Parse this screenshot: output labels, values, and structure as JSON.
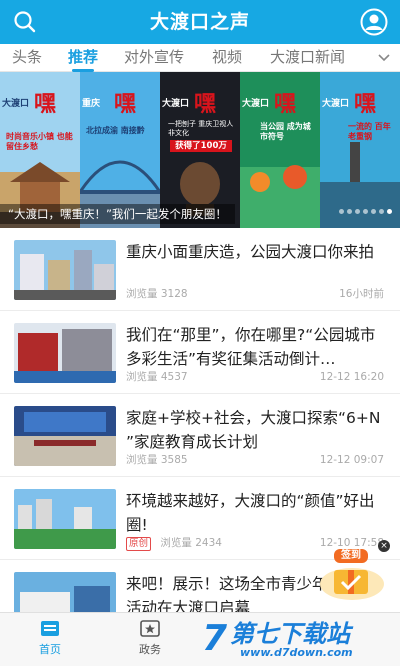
{
  "header": {
    "title": "大渡口之声",
    "search_icon": "search-icon",
    "user_icon": "user-avatar-icon",
    "color": "#17a8e3"
  },
  "tabs": [
    {
      "label": "头条",
      "active": false
    },
    {
      "label": "推荐",
      "active": true
    },
    {
      "label": "对外宣传",
      "active": false
    },
    {
      "label": "视频",
      "active": false
    },
    {
      "label": "大渡口新闻",
      "active": false
    }
  ],
  "banner": {
    "caption": "“大渡口，嘿重庆！”我们一起发个朋友圈！",
    "brand": "大渡口",
    "brand2": "重庆",
    "hei": "嘿",
    "panels": [
      {
        "sub": "时尚音乐小镇 也能留住乡愁",
        "badge": ""
      },
      {
        "sub": "北拉成渝 南接黔",
        "badge": ""
      },
      {
        "sub": "一把刨子 重庆卫视人非文化",
        "badge": "获得了100万"
      },
      {
        "sub": "当公园 成为城市符号",
        "badge": ""
      },
      {
        "sub": "一流的 百年老重钢",
        "badge": ""
      }
    ],
    "dots": 7,
    "active_dot": 6
  },
  "news": [
    {
      "title": "重庆小面重庆造，公园大渡口你来拍",
      "views_label": "浏览量",
      "views": "3128",
      "time": "16小时前",
      "tag": ""
    },
    {
      "title": "我们在“那里”，你在哪里?“公园城市 多彩生活”有奖征集活动倒计…",
      "views_label": "浏览量",
      "views": "4537",
      "time": "12-12 16:20",
      "tag": ""
    },
    {
      "title": "家庭+学校+社会，大渡口探索“6+N ”家庭教育成长计划",
      "views_label": "浏览量",
      "views": "3585",
      "time": "12-12 09:07",
      "tag": ""
    },
    {
      "title": "环境越来越好，大渡口的“颜值”好出圈!",
      "views_label": "浏览量",
      "views": "2434",
      "time": "12-10 17:58",
      "tag": "原创"
    },
    {
      "title": "来吧！展示！这场全市青少年艺术节活动在大渡口启幕",
      "views_label": "",
      "views": "",
      "time": "",
      "tag": ""
    }
  ],
  "signin": {
    "label": "签到",
    "close": "×"
  },
  "bottomnav": [
    {
      "label": "首页",
      "icon": "home-icon",
      "active": true
    },
    {
      "label": "政务",
      "icon": "government-icon",
      "active": false
    }
  ],
  "watermark": {
    "big": "第七下载站",
    "small": "www.d7down.com"
  }
}
